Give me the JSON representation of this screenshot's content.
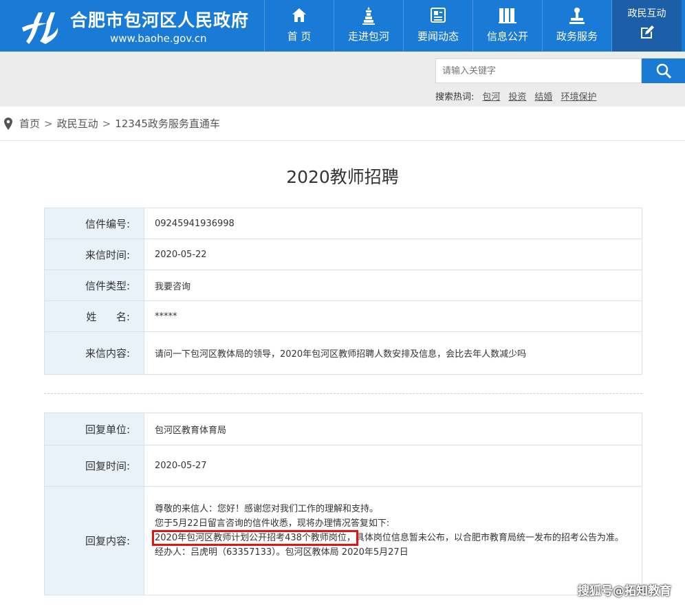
{
  "header": {
    "title": "合肥市包河区人民政府",
    "url": "www.baohe.gov.cn",
    "nav": [
      {
        "label": "首  页",
        "icon": "home-icon"
      },
      {
        "label": "走进包河",
        "icon": "tower-icon"
      },
      {
        "label": "要闻动态",
        "icon": "news-icon"
      },
      {
        "label": "信息公开",
        "icon": "books-icon"
      },
      {
        "label": "政务服务",
        "icon": "stamp-icon"
      },
      {
        "label": "政民互动",
        "icon": "edit-icon"
      }
    ],
    "brand_color": "#1a7bd6",
    "active_color": "#1c5fa8"
  },
  "search": {
    "placeholder": "请输入关键字",
    "hot_label": "搜索热词:",
    "hot_words": [
      "包河",
      "投资",
      "结婚",
      "环境保护"
    ]
  },
  "breadcrumb": [
    "首页",
    "政民互动",
    "12345政务服务直通车"
  ],
  "page_title": "2020教师招聘",
  "letter": [
    {
      "label": "信件编号:",
      "value": "09245941936998"
    },
    {
      "label": "来信时间:",
      "value": "2020-05-22"
    },
    {
      "label": "信件类型:",
      "value": "我要咨询"
    },
    {
      "label": "姓      名:",
      "value": "*****"
    },
    {
      "label": "来信内容:",
      "value": "请问一下包河区教体局的领导，2020年包河区教师招聘人数安排及信息，会比去年人数减少吗"
    }
  ],
  "reply": {
    "unit_label": "回复单位:",
    "unit": "包河区教育体育局",
    "time_label": "回复时间:",
    "time": "2020-05-27",
    "content_label": "回复内容:",
    "line1": "尊敬的来信人：您好！感谢您对我们工作的理解和支持。",
    "line2": "您于5月22日留言咨询的信件收悉，现将办理情况答复如下:",
    "line3_highlight": "2020年包河区教师计划公开招考438个教师岗位，",
    "line3_rest": "具体岗位信息暂未公布，以合肥市教育局统一发布的招考公告为准。",
    "line4": "经办人：吕虎明（63357133）。包河区教体局 2020年5月27日",
    "highlight_color": "#e01414"
  },
  "watermark": "搜狐号@拓知教育"
}
